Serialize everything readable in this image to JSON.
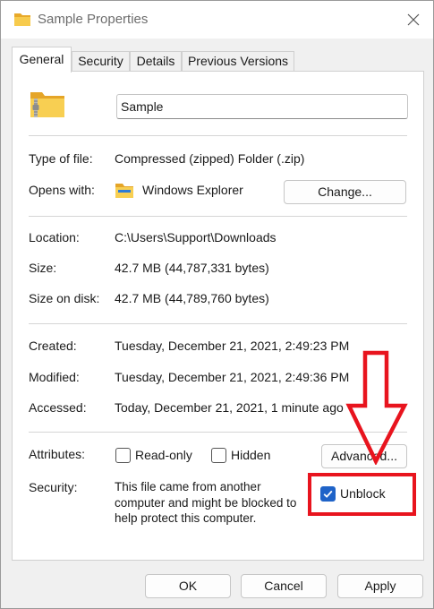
{
  "window": {
    "title": "Sample Properties"
  },
  "tabs": [
    {
      "label": "General"
    },
    {
      "label": "Security"
    },
    {
      "label": "Details"
    },
    {
      "label": "Previous Versions"
    }
  ],
  "general": {
    "name_value": "Sample",
    "type_label": "Type of file:",
    "type_value": "Compressed (zipped) Folder (.zip)",
    "opens_label": "Opens with:",
    "opens_value": "Windows Explorer",
    "change_label": "Change...",
    "location_label": "Location:",
    "location_value": "C:\\Users\\Support\\Downloads",
    "size_label": "Size:",
    "size_value": "42.7 MB (44,787,331 bytes)",
    "size_on_disk_label": "Size on disk:",
    "size_on_disk_value": "42.7 MB (44,789,760 bytes)",
    "created_label": "Created:",
    "created_value": "Tuesday, December 21, 2021, 2:49:23 PM",
    "modified_label": "Modified:",
    "modified_value": "Tuesday, December 21, 2021, 2:49:36 PM",
    "accessed_label": "Accessed:",
    "accessed_value": "Today, December 21, 2021, 1 minute ago",
    "attributes_label": "Attributes:",
    "readonly_label": "Read-only",
    "hidden_label": "Hidden",
    "advanced_label": "Advanced...",
    "security_label": "Security:",
    "security_text_1": "This file came from another",
    "security_text_2": "computer and might be blocked to",
    "security_text_3": "help protect this computer.",
    "unblock_label": "Unblock",
    "readonly_checked": false,
    "hidden_checked": false,
    "unblock_checked": true
  },
  "footer": {
    "ok_label": "OK",
    "cancel_label": "Cancel",
    "apply_label": "Apply"
  },
  "colors": {
    "accent": "#1f63c8",
    "annotation": "#e8141e",
    "folder": "#f2c14a"
  }
}
